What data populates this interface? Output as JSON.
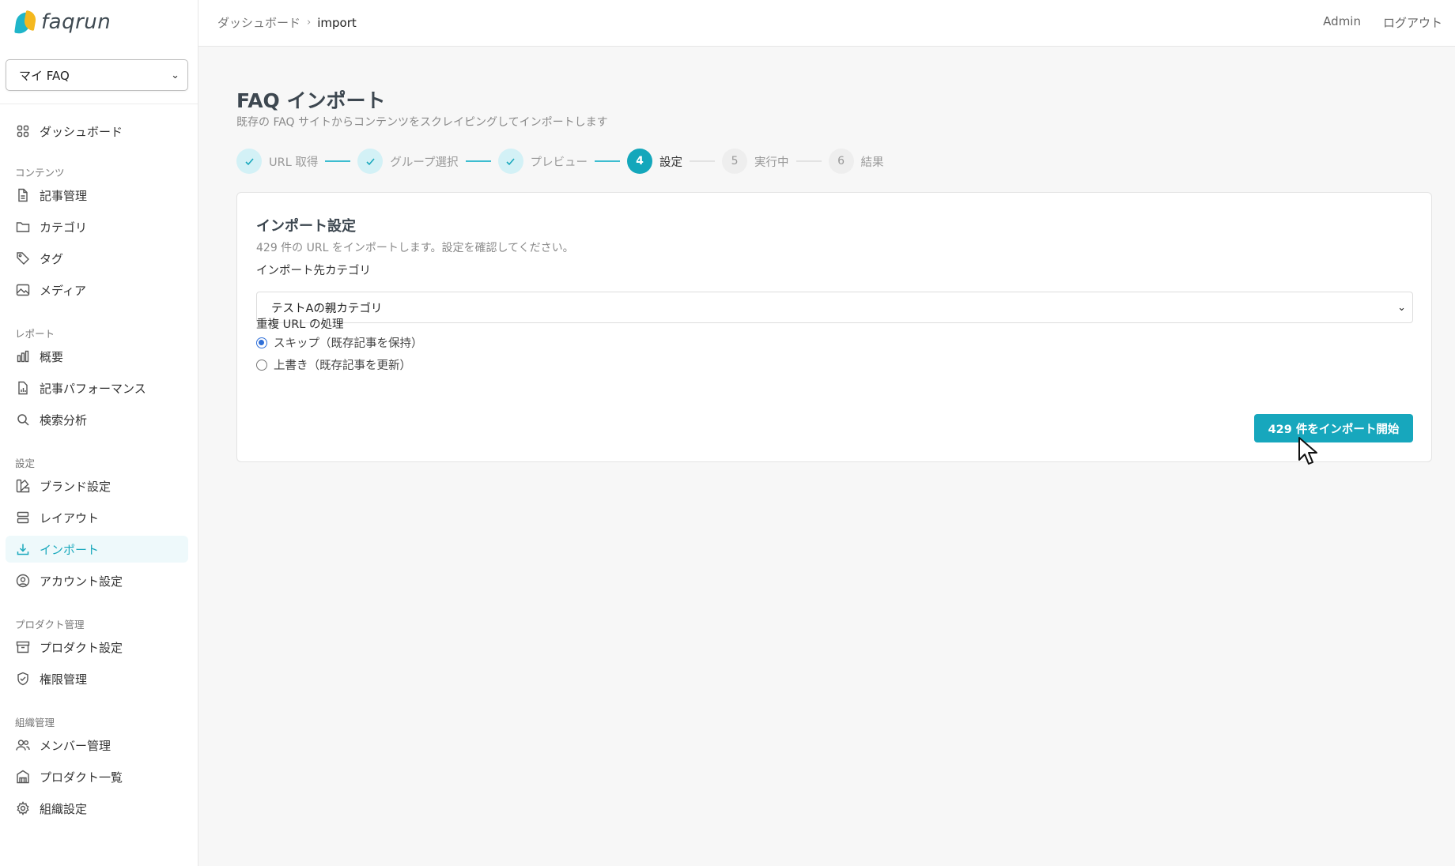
{
  "app": {
    "logo_text": "faqrun"
  },
  "sidebar": {
    "faq_selector": {
      "value": "マイ FAQ"
    },
    "dashboard": {
      "label": "ダッシュボード",
      "icon": "grid-icon"
    },
    "sections": [
      {
        "title": "コンテンツ",
        "items": [
          {
            "label": "記事管理",
            "icon": "document-icon"
          },
          {
            "label": "カテゴリ",
            "icon": "folder-icon"
          },
          {
            "label": "タグ",
            "icon": "tag-icon"
          },
          {
            "label": "メディア",
            "icon": "image-icon"
          }
        ]
      },
      {
        "title": "レポート",
        "items": [
          {
            "label": "概要",
            "icon": "bar-chart-icon"
          },
          {
            "label": "記事パフォーマンス",
            "icon": "document-chart-icon"
          },
          {
            "label": "検索分析",
            "icon": "search-icon"
          }
        ]
      },
      {
        "title": "設定",
        "items": [
          {
            "label": "ブランド設定",
            "icon": "palette-icon"
          },
          {
            "label": "レイアウト",
            "icon": "layout-icon"
          },
          {
            "label": "インポート",
            "icon": "download-icon",
            "active": true
          },
          {
            "label": "アカウント設定",
            "icon": "user-circle-icon"
          }
        ]
      },
      {
        "title": "プロダクト管理",
        "items": [
          {
            "label": "プロダクト設定",
            "icon": "archive-icon"
          },
          {
            "label": "権限管理",
            "icon": "shield-icon"
          }
        ]
      },
      {
        "title": "組織管理",
        "items": [
          {
            "label": "メンバー管理",
            "icon": "users-icon"
          },
          {
            "label": "プロダクト一覧",
            "icon": "building-icon"
          },
          {
            "label": "組織設定",
            "icon": "gear-icon"
          }
        ]
      }
    ]
  },
  "header": {
    "breadcrumb": [
      "ダッシュボード",
      "import"
    ],
    "user": "Admin",
    "logout": "ログアウト"
  },
  "page": {
    "title": "FAQ インポート",
    "subtitle": "既存の FAQ サイトからコンテンツをスクレイピングしてインポートします"
  },
  "stepper": {
    "steps": [
      {
        "num": "1",
        "label": "URL 取得",
        "state": "done"
      },
      {
        "num": "2",
        "label": "グループ選択",
        "state": "done"
      },
      {
        "num": "3",
        "label": "プレビュー",
        "state": "done"
      },
      {
        "num": "4",
        "label": "設定",
        "state": "current"
      },
      {
        "num": "5",
        "label": "実行中",
        "state": "todo"
      },
      {
        "num": "6",
        "label": "結果",
        "state": "todo"
      }
    ]
  },
  "card": {
    "title": "インポート設定",
    "subtitle": "429 件の URL をインポートします。設定を確認してください。",
    "category_label": "インポート先カテゴリ",
    "category_value": "テストAの親カテゴリ",
    "duplicate_label": "重複 URL の処理",
    "options": [
      {
        "label": "スキップ（既存記事を保持）",
        "selected": true
      },
      {
        "label": "上書き（既存記事を更新）",
        "selected": false
      }
    ],
    "submit_label": "429 件をインポート開始"
  },
  "colors": {
    "accent": "#17a7bd",
    "accent_light": "#d3f1f6",
    "radio": "#2f6fd8"
  }
}
